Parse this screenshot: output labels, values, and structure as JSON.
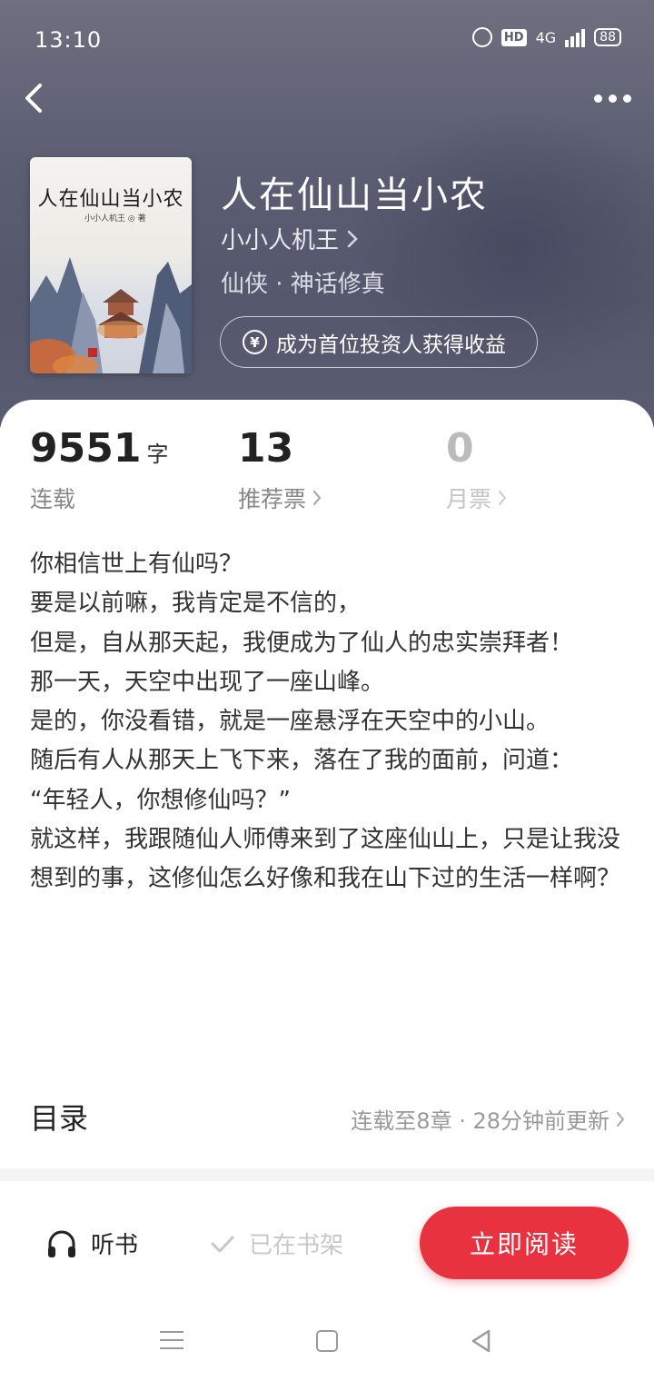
{
  "status_bar": {
    "time": "13:10",
    "network": "4G",
    "hd": "HD",
    "battery": "88"
  },
  "book": {
    "title": "人在仙山当小农",
    "author": "小小人机王",
    "genre": "仙侠 · 神话修真",
    "cover_title": "人在仙山当小农",
    "cover_author": "小小人机王 ◎ 著",
    "invest_label": "成为首位投资人获得收益"
  },
  "stats": {
    "words": {
      "value": "9551",
      "unit": "字",
      "label": "连载"
    },
    "recommend": {
      "value": "13",
      "label": "推荐票"
    },
    "monthly": {
      "value": "0",
      "label": "月票"
    }
  },
  "synopsis": [
    "你相信世上有仙吗？",
    "要是以前嘛，我肯定是不信的，",
    "但是，自从那天起，我便成为了仙人的忠实崇拜者！",
    "那一天，天空中出现了一座山峰。",
    "是的，你没看错，就是一座悬浮在天空中的小山。",
    "随后有人从那天上飞下来，落在了我的面前，问道：",
    "“年轻人，你想修仙吗？”",
    "就这样，我跟随仙人师傅来到了这座仙山上，只是让我没想到的事，这修仙怎么好像和我在山下过的生活一样啊？"
  ],
  "toc": {
    "title": "目录",
    "info": "连载至8章 · 28分钟前更新"
  },
  "bottom_bar": {
    "listen": "听书",
    "shelf": "已在书架",
    "read": "立即阅读"
  },
  "colors": {
    "accent": "#e8323f",
    "hero_bg": "#5b5d72"
  },
  "icons": [
    "back-icon",
    "more-icon",
    "yen-icon",
    "chevron-right-icon",
    "headphones-icon",
    "check-icon",
    "menu-icon",
    "home-icon",
    "nav-back-icon"
  ]
}
